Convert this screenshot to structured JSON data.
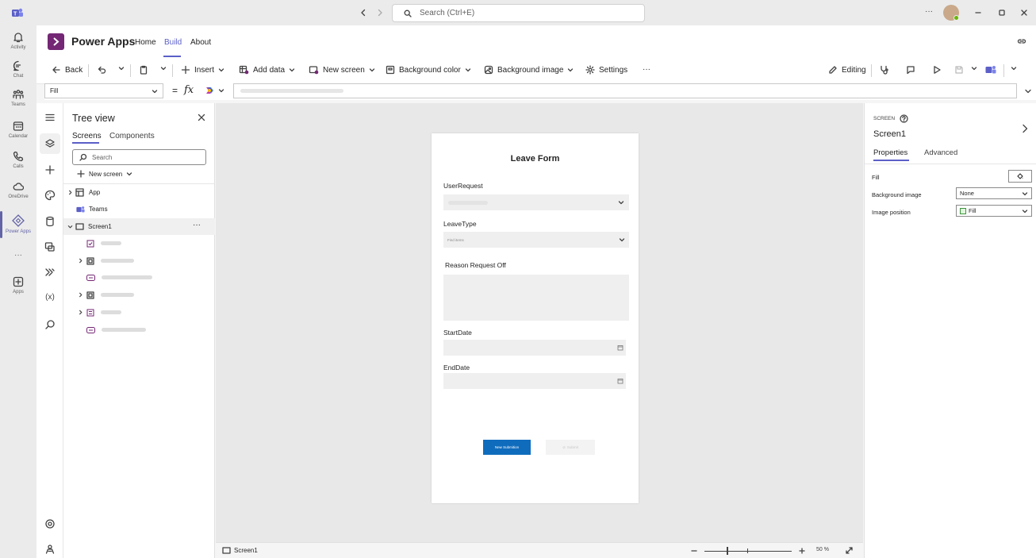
{
  "titlebar": {
    "search_placeholder": "Search (Ctrl+E)",
    "more": "···"
  },
  "rail": {
    "items": [
      {
        "label": "Activity"
      },
      {
        "label": "Chat"
      },
      {
        "label": "Teams"
      },
      {
        "label": "Calendar"
      },
      {
        "label": "Calls"
      },
      {
        "label": "OneDrive"
      },
      {
        "label": "Power Apps"
      },
      {
        "label": "···"
      },
      {
        "label": "Apps"
      }
    ]
  },
  "header": {
    "app_title": "Power Apps",
    "tabs": [
      "Home",
      "Build",
      "About"
    ],
    "active_tab": "Build"
  },
  "commandbar": {
    "back": "Back",
    "insert": "Insert",
    "add_data": "Add data",
    "new_screen": "New screen",
    "background_color": "Background color",
    "background_image": "Background image",
    "settings": "Settings",
    "more": "···",
    "editing": "Editing"
  },
  "formula": {
    "property": "Fill",
    "equals": "=",
    "fx": "fx"
  },
  "tree": {
    "title": "Tree view",
    "tabs": [
      "Screens",
      "Components"
    ],
    "active_tab": "Screens",
    "search_placeholder": "Search",
    "new_screen": "New screen",
    "items": [
      {
        "label": "App"
      },
      {
        "label": "Teams"
      },
      {
        "label": "Screen1"
      }
    ],
    "more": "···"
  },
  "form": {
    "title": "Leave Form",
    "fields": [
      {
        "label": "UserRequest"
      },
      {
        "label": "LeaveType"
      },
      {
        "label": "Reason Request Off"
      },
      {
        "label": "StartDate"
      },
      {
        "label": "EndDate"
      }
    ],
    "find_items": "Find items",
    "new_submission": "New Submition",
    "submit": "Submit"
  },
  "status": {
    "screen_name": "Screen1",
    "zoom": "50 %"
  },
  "properties": {
    "kind": "SCREEN",
    "name": "Screen1",
    "tabs": [
      "Properties",
      "Advanced"
    ],
    "active_tab": "Properties",
    "rows": [
      {
        "label": "Fill",
        "value": ""
      },
      {
        "label": "Background image",
        "value": "None"
      },
      {
        "label": "Image position",
        "value": "Fill"
      }
    ]
  },
  "colors": {
    "accent": "#5b5fc7",
    "power_apps": "#742774",
    "primary_button": "#0f6cbd"
  }
}
